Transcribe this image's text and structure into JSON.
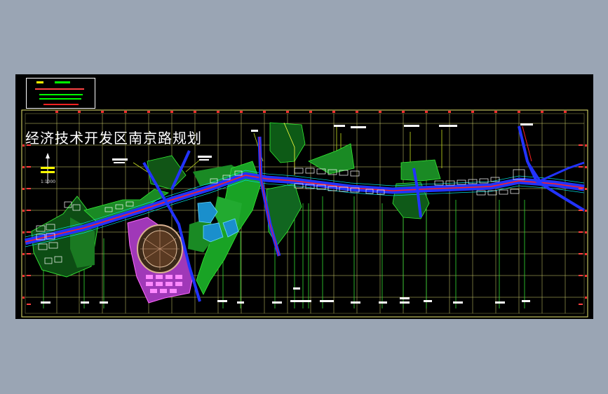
{
  "drawing": {
    "title": "经济技术开发区南京路规划",
    "scale": "1:1000"
  },
  "colors": {
    "background": "#9aa5b4",
    "canvas": "#000000",
    "grid": "#e8e870",
    "road_blue": "#2233ff",
    "road_red": "#ff2020",
    "green": "#22cc33",
    "cyan": "#00e0e0",
    "magenta": "#ff55ff",
    "white": "#ffffff"
  }
}
